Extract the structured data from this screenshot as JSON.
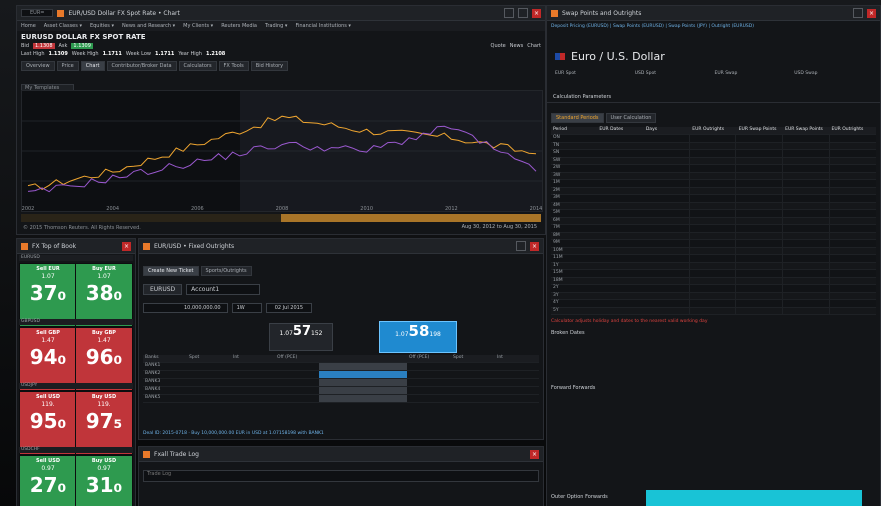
{
  "main_window": {
    "title": "EUR/USD Dollar FX Spot Rate • Chart",
    "search_value": "EUR=",
    "menu": [
      "Home",
      "Asset Classes ▾",
      "Equities ▾",
      "News and Research ▾",
      "My Clients ▾",
      "Reuters Media",
      "Trading ▾",
      "Financial Institutions ▾"
    ],
    "instrument_title": "EURUSD DOLLAR FX SPOT RATE",
    "bid_label": "Bid",
    "bid_value": "1.1308",
    "ask_label": "Ask",
    "ask_value": "1.1309",
    "last_label": "Last High",
    "last_value": "1.1309",
    "week_high_label": "Week High",
    "week_high_value": "1.1711",
    "low_label": "Week Low",
    "low_value": "1.1711",
    "range_label": "Year High",
    "range_value": "1.2108",
    "quote_label": "Quote",
    "news_label": "News",
    "chart_label": "Chart",
    "tabs": [
      "Overview",
      "Price",
      "Chart",
      "Contributor/Broker Data",
      "Calculators",
      "FX Tools",
      "Bid History"
    ],
    "template_value": "My Templates",
    "date_range_label": "Aug 30, 2012 to Aug 30, 2015",
    "disclaimer": "© 2015 Thomson Reuters. All Rights Reserved."
  },
  "chart_data": {
    "type": "line",
    "x": [
      "2002",
      "2004",
      "2006",
      "2008",
      "2010",
      "2012",
      "2014"
    ],
    "series": [
      {
        "values": [
          0.92,
          1.05,
          1.25,
          1.45,
          1.35,
          1.3,
          1.18
        ]
      },
      {
        "values": [
          0.88,
          1.0,
          1.12,
          1.25,
          1.2,
          1.38,
          1.05
        ]
      }
    ],
    "ylim": [
      0.8,
      1.6
    ],
    "grid": true
  },
  "top_of_book": {
    "title": "FX Top of Book",
    "pairs": [
      {
        "pair": "EURUSD",
        "sell": "Sell EUR",
        "buy": "Buy EUR",
        "sell_rate": "1.07",
        "buy_rate": "1.07",
        "sell_big": "37₀",
        "buy_big": "38₀",
        "color": "#2e9a4f"
      },
      {
        "pair": "GBPUSD",
        "sell": "Sell GBP",
        "buy": "Buy GBP",
        "sell_rate": "1.47",
        "buy_rate": "1.47",
        "sell_big": "94₀",
        "buy_big": "96₀",
        "color": "#c0353a"
      },
      {
        "pair": "USDJPY",
        "sell": "Sell USD",
        "buy": "Buy USD",
        "sell_rate": "119.",
        "buy_rate": "119.",
        "sell_big": "95₀",
        "buy_big": "97₅",
        "color": "#c0353a"
      },
      {
        "pair": "USDCHF",
        "sell": "Sell USD",
        "buy": "Buy USD",
        "sell_rate": "0.97",
        "buy_rate": "0.97",
        "sell_big": "27₀",
        "buy_big": "31₀",
        "color": "#2e9a4f"
      }
    ]
  },
  "order_window": {
    "title": "EUR/USD • Fixed Outrights",
    "tabs": [
      "Create New Ticket",
      "Sports/Outrights"
    ],
    "pair_value": "EURUSD",
    "account_value": "Account1",
    "amount_value": "10,000,000.00",
    "date_value": "02 Jul 2015",
    "tenor_value": "1W",
    "sell_big": "1.07",
    "sell_pips": "57",
    "sell_frac": "152",
    "buy_big": "1.07",
    "buy_pips": "58",
    "buy_frac": "198",
    "columns": [
      "Banks",
      "Spot",
      "Int",
      "Off (PCE)",
      "",
      "",
      "Off (PCE)",
      "Spot",
      "Int"
    ],
    "rows": [
      "BANK1",
      "BANK2",
      "BANK3",
      "BANK4",
      "BANK5"
    ],
    "footer": "Deal ID: 2015-0718 · Buy 10,000,000.00 EUR in USD at 1.07158198 with BANK1"
  },
  "trade_log": {
    "title": "Fxall Trade Log",
    "placeholder": "Trade Log"
  },
  "swap_window": {
    "title": "Swap Points and Outrights",
    "subtitle": "Deposit Pricing (EURUSD) | Swap Points (EURUSD) | Swap Points (JPY) | Outright (EURUSD)",
    "currency_title": "Euro / U.S. Dollar",
    "col_headers": [
      "EUR Spot",
      "USD Spot",
      "EUR Swap",
      "USD Swap"
    ],
    "section": "Calculation Parameters",
    "std_periods": "Standard Periods",
    "user_calc": "User Calculation",
    "table_headers": [
      "Period",
      "EUR Dates",
      "Days",
      "EUR Outrights",
      "EUR Swap Points",
      "EUR Swap Points",
      "EUR Outrights"
    ],
    "periods": [
      "ON",
      "TN",
      "SN",
      "SW",
      "2W",
      "3W",
      "1M",
      "2M",
      "3M",
      "4M",
      "5M",
      "6M",
      "7M",
      "8M",
      "9M",
      "10M",
      "11M",
      "1Y",
      "15M",
      "18M",
      "2Y",
      "3Y",
      "4Y",
      "5Y"
    ],
    "warning": "Calculator adjusts holiday and dates to the nearest valid working day",
    "broken_dates": "Broken Dates",
    "forward_section": "Forward Forwards",
    "bottom_label": "Outer Option Forwards"
  }
}
